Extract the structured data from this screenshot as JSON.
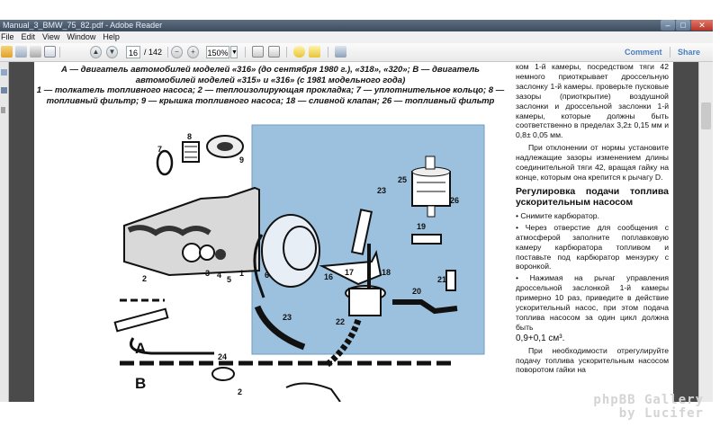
{
  "window": {
    "title": "Manual_3_BMW_75_82.pdf - Adobe Reader",
    "minimize": "–",
    "maximize": "□",
    "close": "✕"
  },
  "menu": [
    "File",
    "Edit",
    "View",
    "Window",
    "Help"
  ],
  "toolbar": {
    "page_current": "16",
    "page_total": "/ 142",
    "zoom": "150%",
    "comment": "Comment",
    "share": "Share",
    "icons": [
      "open-icon",
      "print-icon",
      "save-icon",
      "email-icon",
      "page-up-icon",
      "page-down-icon",
      "zoom-out-icon",
      "zoom-in-icon",
      "fit-page-icon",
      "fit-width-icon",
      "comment-icon",
      "highlight-icon",
      "sign-icon"
    ]
  },
  "document": {
    "caption_line1": "А — двигатель автомобилей моделей «316» (до сентября 1980 г.), «318», «320»; В — двигатель автомобилей моделей «315» и «316» (с 1981 модельного года)",
    "caption_line2": "1 — толкатель топливного насоса; 2 — теплоизолирующая прокладка; 7 — уплотнительное кольцо; 8 — топливный фильтр; 9 — крышка топливного насоса; 18 — сливной клапан; 26 — топливный фильтр",
    "right_column": {
      "p1": "ком 1-й камеры, посредством тяги 42 немного приоткрывает дроссельную заслонку 1-й камеры. проверьте пусковые зазоры (приоткрытие) воздушной заслонки и дроссельной заслонки 1-й камеры, которые должны быть соответственно в пределах 3,2± 0,15 мм и 0,8± 0,05 мм.",
      "p2": "При отклонении от нормы установите надлежащие зазоры изменением длины соединительной тяги 42, вращая гайку на конце, которым она крепится к рычагу D.",
      "heading": "Регулировка подачи топлива ускорительным насосом",
      "b1": "• Снимите карбюратор.",
      "b2": "• Через отверстие для сообщения с атмосферой заполните поплавковую камеру карбюратора топливом и поставьте под карбюратор мензурку с воронкой.",
      "b3": "• Нажимая на рычаг управления дроссельной заслонкой 1-й камеры примерно 10 раз, приведите в действие ускорительный насос, при этом подача топлива насосом за один цикл должна быть",
      "value": "0,9+0,1 см³.",
      "p3": "При необходимости отрегулируйте подачу топлива ускорительным насосом поворотом гайки на"
    },
    "diagram": {
      "label_A": "А",
      "label_B": "В",
      "numbers": [
        "7",
        "8",
        "9",
        "2",
        "3",
        "4",
        "5",
        "1",
        "6",
        "16",
        "17",
        "18",
        "19",
        "20",
        "21",
        "22",
        "23",
        "23",
        "24",
        "25",
        "26",
        "2"
      ]
    }
  },
  "watermark": {
    "line1": "phpBB Gallery",
    "line2": "by Lucifer"
  }
}
